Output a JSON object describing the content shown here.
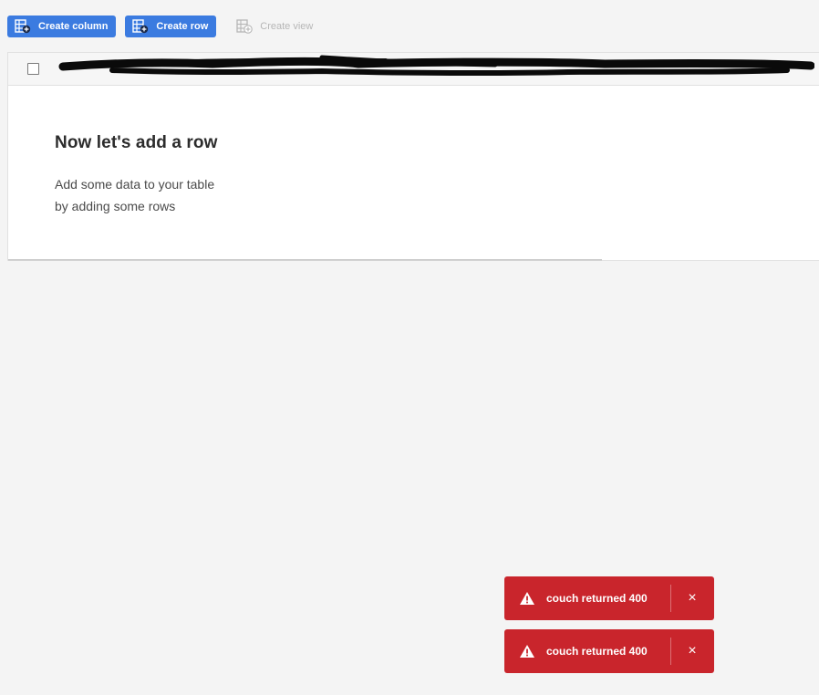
{
  "toolbar": {
    "create_column": "Create column",
    "create_row": "Create row",
    "create_view": "Create view"
  },
  "empty_state": {
    "title": "Now let's add a row",
    "line1": "Add some data to your table",
    "line2": "by adding some rows"
  },
  "toasts": [
    {
      "message": "couch returned 400",
      "close": "×"
    },
    {
      "message": "couch returned 400",
      "close": "×"
    }
  ],
  "colors": {
    "accent": "#3b7be0",
    "error": "#c9252c",
    "background": "#f4f4f4"
  }
}
